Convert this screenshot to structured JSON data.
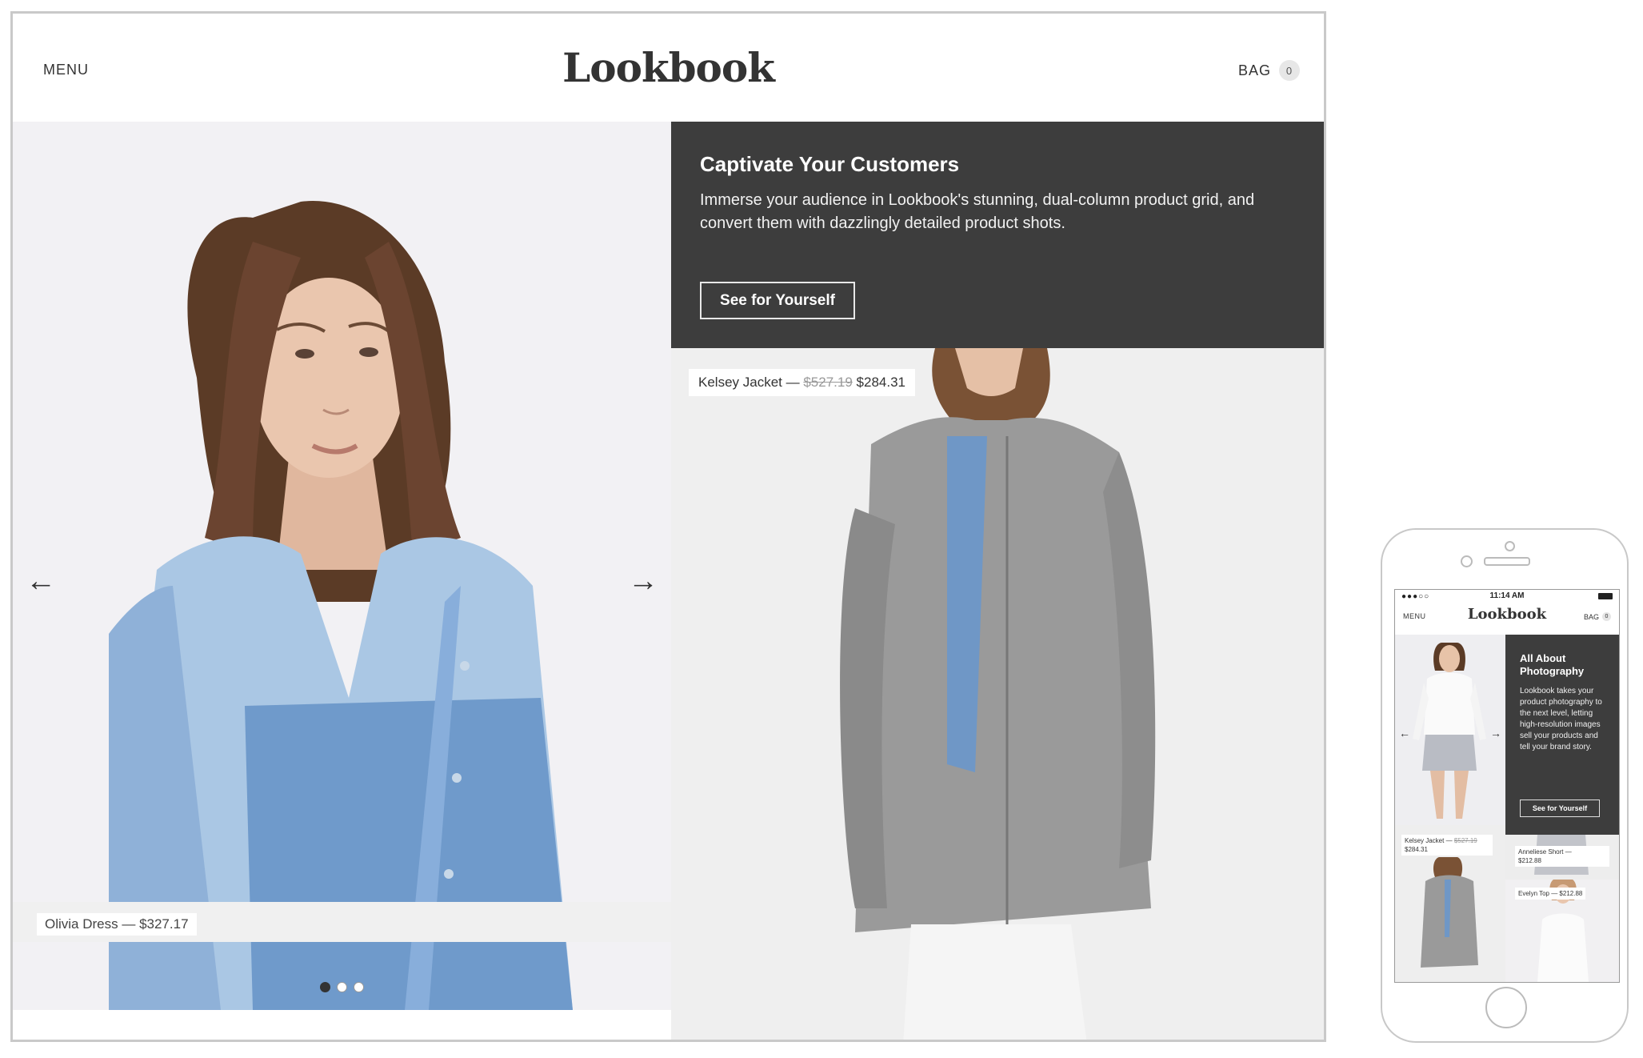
{
  "desktop": {
    "header": {
      "menu_label": "MENU",
      "logo": "Lookbook",
      "bag_label": "BAG",
      "bag_count": "0"
    },
    "hero": {
      "prev_arrow": "←",
      "next_arrow": "→",
      "slide_count": 3,
      "active_slide": 1,
      "caption": "Olivia Dress — $327.17"
    },
    "promo": {
      "title": "Captivate Your Customers",
      "text": "Immerse your audience in Lookbook's stunning, dual-column product grid, and convert them with dazzlingly detailed product shots.",
      "button_label": "See for Yourself"
    },
    "product": {
      "name": "Kelsey Jacket —",
      "old_price": "$527.19",
      "price": "$284.31"
    }
  },
  "phone": {
    "status": {
      "signal": "●●●○○",
      "time": "11:14 AM"
    },
    "header": {
      "menu_label": "MENU",
      "logo": "Lookbook",
      "bag_label": "BAG",
      "bag_count": "0"
    },
    "hero": {
      "prev_arrow": "←",
      "next_arrow": "→"
    },
    "promo": {
      "title": "All About Photography",
      "text": "Lookbook takes your product photography to the next level, letting high-resolution images sell your products and tell your brand story.",
      "button_label": "See for Yourself"
    },
    "products": [
      {
        "name": "Kelsey Jacket —",
        "old_price": "$527.19",
        "price": "$284.31"
      },
      {
        "name": "Anneliese Short —",
        "price": "$212.88"
      },
      {
        "name": "Evelyn Top — $212.88"
      }
    ]
  },
  "colors": {
    "promo_bg": "#3d3d3d",
    "accent_text": "#333333"
  }
}
